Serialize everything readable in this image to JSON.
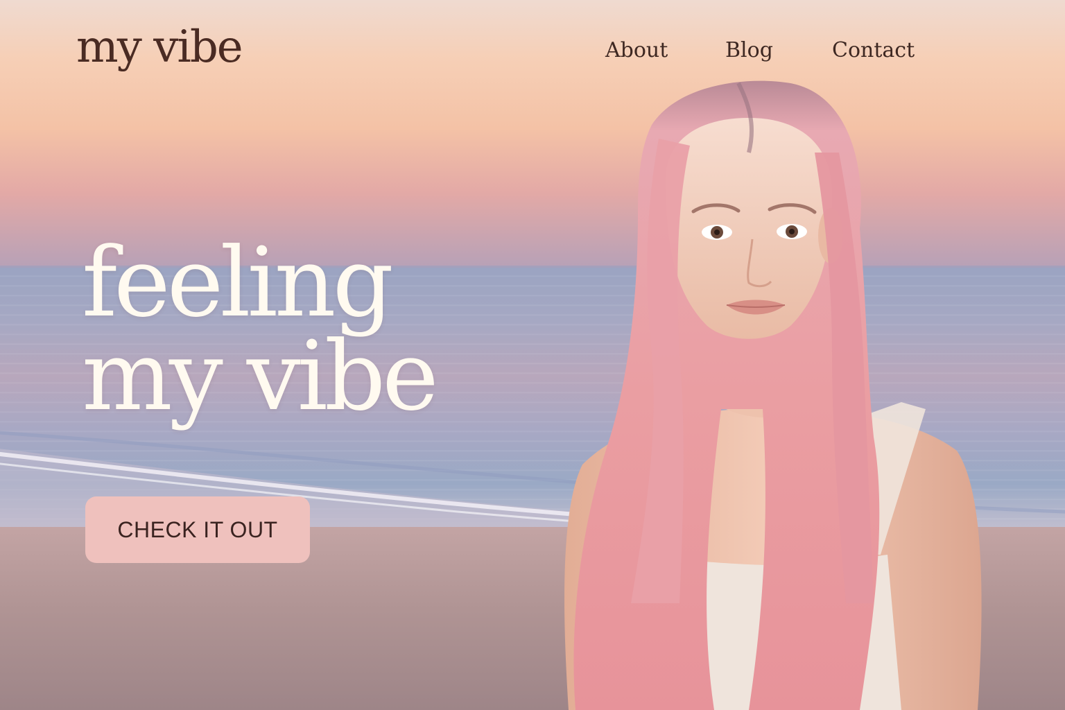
{
  "header": {
    "logo": "my vibe",
    "nav": {
      "about": "About",
      "blog": "Blog",
      "contact": "Contact"
    }
  },
  "hero": {
    "line1": "feeling",
    "line2": "my vibe",
    "cta_label": "CHECK IT OUT"
  },
  "colors": {
    "logo_text": "#4a2b23",
    "hero_text": "#fffaf0",
    "button_bg": "#efc1bd",
    "hair": "#e89ca0"
  },
  "images": {
    "background": "sunset-beach-scene",
    "portrait": "pink-haired-woman-portrait"
  }
}
